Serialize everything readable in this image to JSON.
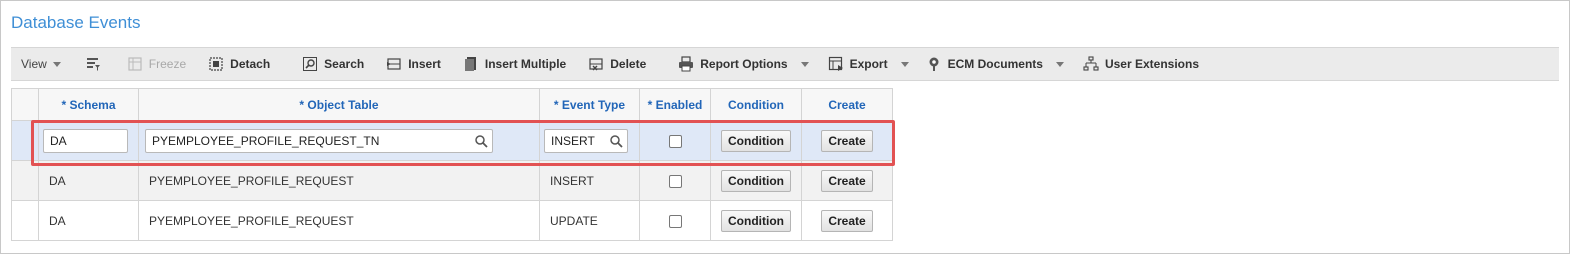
{
  "page": {
    "title": "Database Events"
  },
  "toolbar": {
    "view_label": "View",
    "freeze_label": "Freeze",
    "detach_label": "Detach",
    "search_label": "Search",
    "insert_label": "Insert",
    "insert_multiple_label": "Insert Multiple",
    "delete_label": "Delete",
    "report_options_label": "Report Options",
    "export_label": "Export",
    "ecm_documents_label": "ECM Documents",
    "user_extensions_label": "User Extensions"
  },
  "table": {
    "headers": {
      "schema": "* Schema",
      "object_table": "* Object Table",
      "event_type": "* Event Type",
      "enabled": "* Enabled",
      "condition": "Condition",
      "create": "Create"
    },
    "rows": [
      {
        "schema": "DA",
        "object_table": "PYEMPLOYEE_PROFILE_REQUEST_TN",
        "event_type": "INSERT",
        "enabled": false,
        "condition_button": "Condition",
        "create_button": "Create"
      },
      {
        "schema": "DA",
        "object_table": "PYEMPLOYEE_PROFILE_REQUEST",
        "event_type": "INSERT",
        "enabled": false,
        "condition_button": "Condition",
        "create_button": "Create"
      },
      {
        "schema": "DA",
        "object_table": "PYEMPLOYEE_PROFILE_REQUEST",
        "event_type": "UPDATE",
        "enabled": false,
        "condition_button": "Condition",
        "create_button": "Create"
      }
    ]
  },
  "colors": {
    "title": "#3f8fd6",
    "header_text": "#2266b8",
    "selected_row": "#dfe8f7",
    "highlight_border": "#e25253"
  }
}
